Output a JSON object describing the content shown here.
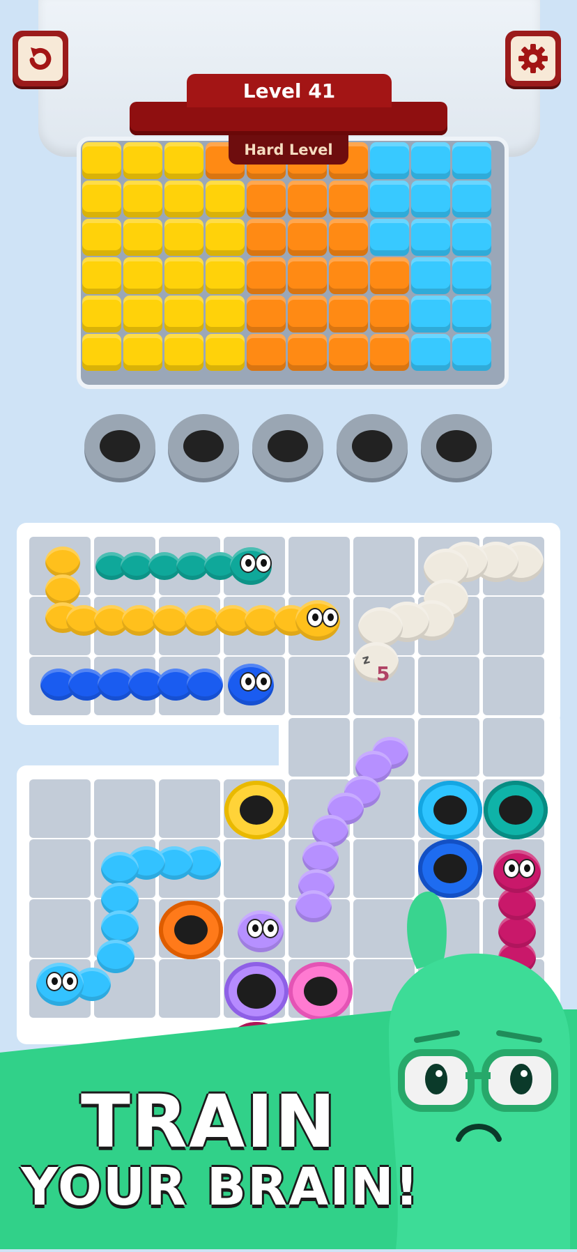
{
  "header": {
    "level_label": "Level 41",
    "difficulty_label": "Hard Level",
    "restart_icon": "restart-icon",
    "settings_icon": "gear-icon"
  },
  "colors": {
    "yellow": "#ffd20a",
    "orange": "#ff8a14",
    "cyan": "#38c9ff",
    "banner": "#a31515"
  },
  "game": {
    "sleep_counter": "5",
    "sleep_symbol": "z"
  },
  "promo": {
    "line1": "TRAIN",
    "line2": "YOUR BRAIN!"
  }
}
